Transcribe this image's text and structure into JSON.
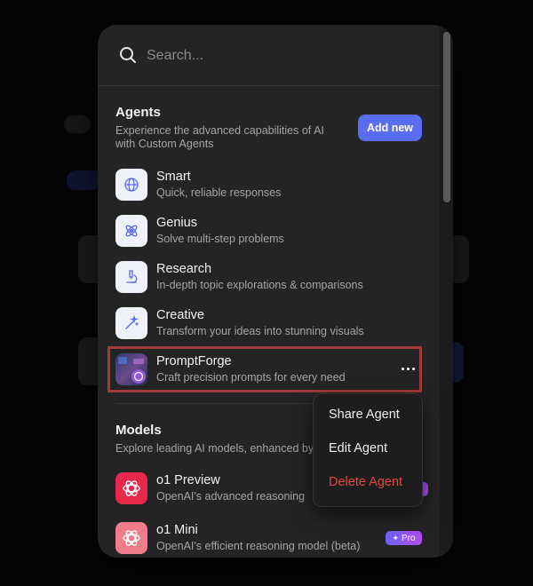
{
  "search": {
    "placeholder": "Search..."
  },
  "agents": {
    "title": "Agents",
    "description": "Experience the advanced capabilities of AI with Custom Agents",
    "add_label": "Add new",
    "items": [
      {
        "name": "Smart",
        "desc": "Quick, reliable responses",
        "icon": "globe-icon"
      },
      {
        "name": "Genius",
        "desc": "Solve multi-step problems",
        "icon": "atom-icon"
      },
      {
        "name": "Research",
        "desc": "In-depth topic explorations & comparisons",
        "icon": "microscope-icon"
      },
      {
        "name": "Creative",
        "desc": "Transform your ideas into stunning visuals",
        "icon": "magic-wand-icon"
      },
      {
        "name": "PromptForge",
        "desc": "Craft precision prompts for every need",
        "icon": "promptforge-avatar"
      }
    ]
  },
  "models": {
    "title": "Models",
    "description": "Explore leading AI models, enhanced by",
    "items": [
      {
        "name": "o1 Preview",
        "desc": "OpenAI's advanced reasoning",
        "color": "#e8284a"
      },
      {
        "name": "o1 Mini",
        "desc": "OpenAI's efficient reasoning model (beta)",
        "color": "#f07b8a",
        "badge": "Pro"
      }
    ]
  },
  "context_menu": {
    "share": "Share Agent",
    "edit": "Edit Agent",
    "delete": "Delete Agent"
  },
  "colors": {
    "accent": "#5a6cf0",
    "danger": "#e5483f",
    "highlight": "#a33a3a"
  }
}
